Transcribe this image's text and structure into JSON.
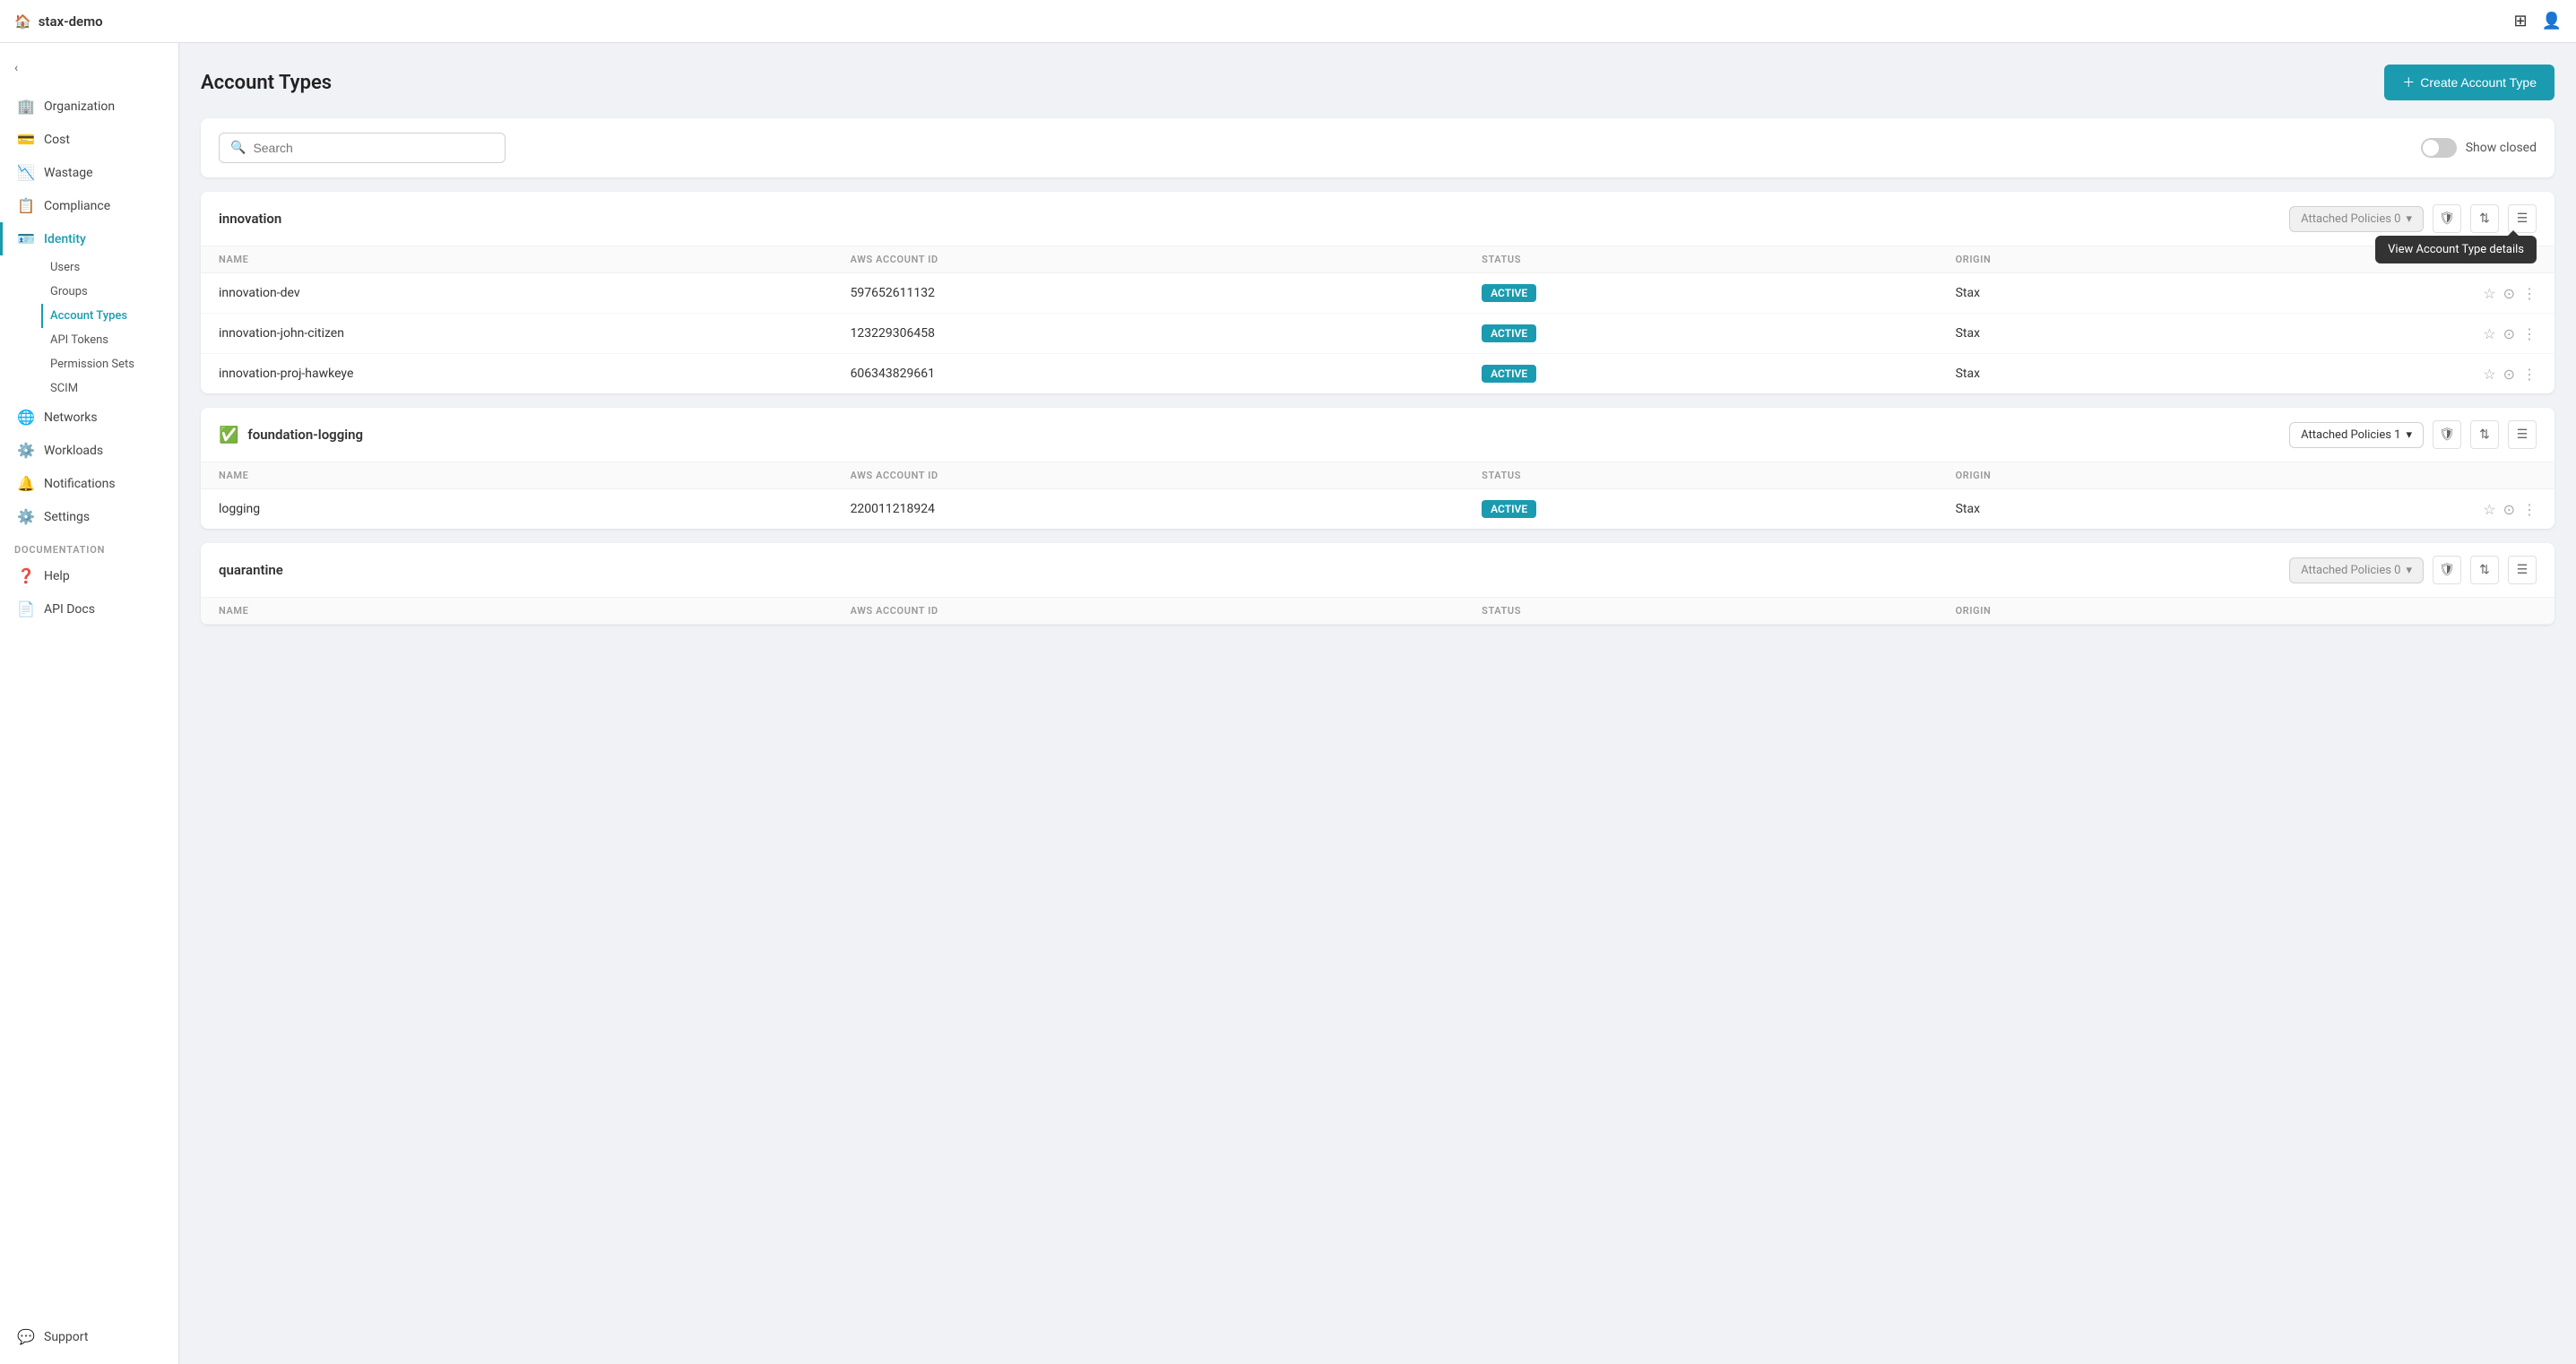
{
  "app": {
    "name": "stax-demo",
    "topbar_icons": [
      "grid-icon",
      "user-icon"
    ]
  },
  "sidebar": {
    "toggle_label": "collapse",
    "nav_items": [
      {
        "id": "organization",
        "label": "Organization",
        "icon": "🏢"
      },
      {
        "id": "cost",
        "label": "Cost",
        "icon": "💰"
      },
      {
        "id": "wastage",
        "label": "Wastage",
        "icon": "📉"
      },
      {
        "id": "compliance",
        "label": "Compliance",
        "icon": "📋"
      },
      {
        "id": "identity",
        "label": "Identity",
        "icon": "🪪",
        "active": true
      }
    ],
    "identity_subitems": [
      {
        "id": "users",
        "label": "Users"
      },
      {
        "id": "groups",
        "label": "Groups"
      },
      {
        "id": "account-types",
        "label": "Account Types",
        "active": true
      },
      {
        "id": "api-tokens",
        "label": "API Tokens"
      },
      {
        "id": "permission-sets",
        "label": "Permission Sets"
      },
      {
        "id": "scim",
        "label": "SCIM"
      }
    ],
    "more_nav": [
      {
        "id": "networks",
        "label": "Networks",
        "icon": "🌐"
      },
      {
        "id": "workloads",
        "label": "Workloads",
        "icon": "⚙️"
      },
      {
        "id": "notifications",
        "label": "Notifications",
        "icon": "🔔"
      },
      {
        "id": "settings",
        "label": "Settings",
        "icon": "⚙️"
      }
    ],
    "documentation_section": "DOCUMENTATION",
    "doc_items": [
      {
        "id": "help",
        "label": "Help",
        "icon": "❓"
      },
      {
        "id": "api-docs",
        "label": "API Docs",
        "icon": "📄"
      }
    ],
    "bottom_items": [
      {
        "id": "support",
        "label": "Support",
        "icon": "💬"
      }
    ]
  },
  "page": {
    "title": "Account Types",
    "create_button": "Create Account Type"
  },
  "search": {
    "placeholder": "Search",
    "show_closed_label": "Show closed"
  },
  "tooltip": {
    "text": "View Account Type details"
  },
  "account_type_groups": [
    {
      "id": "innovation",
      "name": "innovation",
      "checked": false,
      "attached_policies_label": "Attached Policies 0",
      "columns": [
        "NAME",
        "AWS ACCOUNT ID",
        "STATUS",
        "ORIGIN"
      ],
      "accounts": [
        {
          "name": "innovation-dev",
          "aws_id": "597652611132",
          "status": "ACTIVE",
          "origin": "Stax"
        },
        {
          "name": "innovation-john-citizen",
          "aws_id": "123229306458",
          "status": "ACTIVE",
          "origin": "Stax"
        },
        {
          "name": "innovation-proj-hawkeye",
          "aws_id": "606343829661",
          "status": "ACTIVE",
          "origin": "Stax"
        }
      ]
    },
    {
      "id": "foundation-logging",
      "name": "foundation-logging",
      "checked": true,
      "attached_policies_label": "Attached Policies 1",
      "columns": [
        "NAME",
        "AWS ACCOUNT ID",
        "STATUS",
        "ORIGIN"
      ],
      "accounts": [
        {
          "name": "logging",
          "aws_id": "220011218924",
          "status": "ACTIVE",
          "origin": "Stax"
        }
      ]
    },
    {
      "id": "quarantine",
      "name": "quarantine",
      "checked": false,
      "attached_policies_label": "Attached Policies 0",
      "columns": [
        "NAME",
        "AWS ACCOUNT ID",
        "STATUS",
        "ORIGIN"
      ],
      "accounts": []
    }
  ]
}
